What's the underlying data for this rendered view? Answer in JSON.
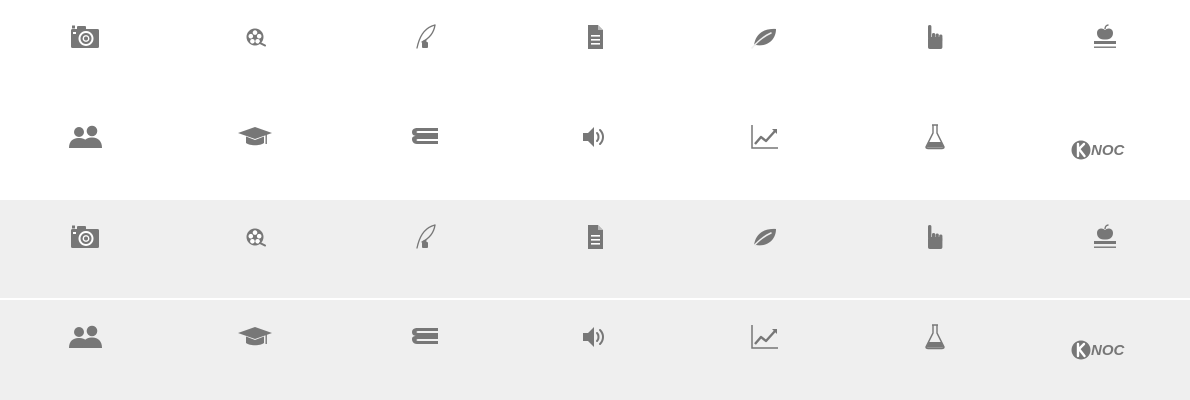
{
  "colors": {
    "icon": "#777777",
    "band_white": "#ffffff",
    "band_grey": "#efefef"
  },
  "grids": [
    {
      "name": "white-panel",
      "rows": [
        [
          "camera-icon",
          "film-reel-icon",
          "quill-ink-icon",
          "document-icon",
          "leaf-icon",
          "hand-pointer-icon",
          "apple-books-icon"
        ],
        [
          "users-icon",
          "graduation-cap-icon",
          "book-stack-icon",
          "speaker-volume-icon",
          "line-chart-icon",
          "flask-icon",
          "knoc-logo"
        ]
      ]
    },
    {
      "name": "grey-panel",
      "rows": [
        [
          "camera-icon",
          "film-reel-icon",
          "quill-ink-icon",
          "document-icon",
          "leaf-icon",
          "hand-pointer-icon",
          "apple-books-icon"
        ],
        [
          "users-icon",
          "graduation-cap-icon",
          "book-stack-icon",
          "speaker-volume-icon",
          "line-chart-icon",
          "flask-icon",
          "knoc-logo"
        ]
      ]
    }
  ],
  "logo": {
    "text": "NOC"
  }
}
